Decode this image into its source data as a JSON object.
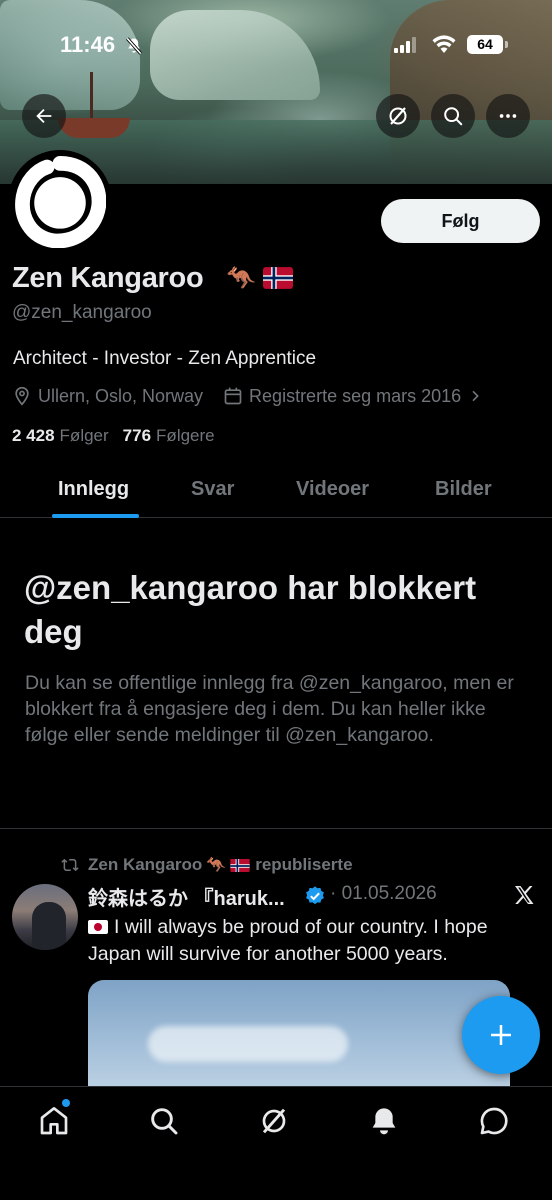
{
  "status_bar": {
    "time": "11:46",
    "battery": "64"
  },
  "profile": {
    "display_name": "Zen Kangaroo",
    "name_emoji": "🦘",
    "handle": "@zen_kangaroo",
    "bio": "Architect - Investor - Zen Apprentice",
    "location": "Ullern, Oslo, Norway",
    "joined": "Registrerte seg mars 2016",
    "following_count": "2 428",
    "following_label": "Følger",
    "followers_count": "776",
    "followers_label": "Følgere",
    "follow_button": "Følg"
  },
  "tabs": [
    {
      "label": "Innlegg",
      "active": true
    },
    {
      "label": "Svar",
      "active": false
    },
    {
      "label": "Videoer",
      "active": false
    },
    {
      "label": "Bilder",
      "active": false
    }
  ],
  "blocked": {
    "title": "@zen_kangaroo har blokkert deg",
    "text": "Du kan se offentlige innlegg fra @zen_kangaroo, men er blokkert fra å engasjere deg i dem. Du kan heller ikke følge eller sende meldinger til @zen_kangaroo."
  },
  "post": {
    "repost_by": "Zen Kangaroo",
    "repost_emoji": "🦘",
    "repost_label": "republiserte",
    "author": "鈴森はるか 『haruk...",
    "date": "01.05.2026",
    "text": "I will always be proud of our country. I hope Japan will survive for another 5000 years."
  },
  "icons": {
    "header": [
      "back-arrow-icon",
      "grok-icon",
      "search-icon",
      "more-icon"
    ],
    "nav": [
      "home-icon",
      "search-icon",
      "grok-icon",
      "bell-icon",
      "messages-icon"
    ]
  },
  "colors": {
    "accent": "#1d9bf0",
    "muted": "#71767b",
    "text": "#e7e9ea",
    "background": "#000000"
  }
}
